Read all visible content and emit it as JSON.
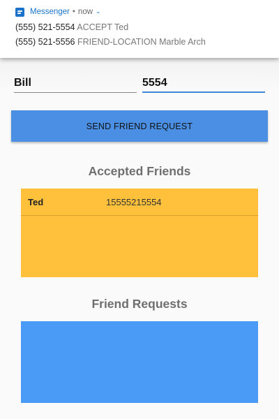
{
  "notification": {
    "app_name": "Messenger",
    "separator": "•",
    "time": "now",
    "lines": [
      {
        "number": "(555) 521-5554",
        "message": "ACCEPT Ted"
      },
      {
        "number": "(555) 521-5556",
        "message": "FRIEND-LOCATION Marble Arch"
      }
    ]
  },
  "form": {
    "name_value": "Bill",
    "phone_value": "5554",
    "send_label": "SEND FRIEND REQUEST"
  },
  "accepted": {
    "title": "Accepted Friends",
    "friends": [
      {
        "name": "Ted",
        "phone": "15555215554"
      }
    ]
  },
  "requests": {
    "title": "Friend Requests",
    "items": []
  },
  "colors": {
    "accent": "#4a8fe3",
    "accepted_bg": "#ffc13b",
    "requests_bg": "#4a9bf5"
  }
}
